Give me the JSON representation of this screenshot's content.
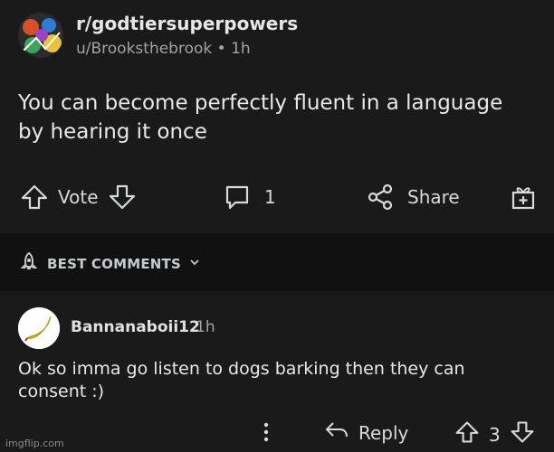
{
  "post": {
    "subreddit": "r/godtiersuperpowers",
    "meta": "u/Brooksthebrook • 1h",
    "title": "You can become perfectly fluent in a language by hearing it once",
    "vote_label": "Vote",
    "comment_count": "1",
    "share_label": "Share"
  },
  "sort": {
    "label": "BEST COMMENTS"
  },
  "comment": {
    "username": "Bannanaboii12",
    "time": "1h",
    "body": "Ok so imma go listen to dogs barking then they can consent :)",
    "reply_label": "Reply",
    "score": "3"
  },
  "watermark": "imgflip.com",
  "colors": {
    "background": "#1a1a1b",
    "band": "#111112",
    "text": "#d7dadc",
    "muted": "#a0a3a6",
    "banana": "#f2c200"
  },
  "icons": [
    "upvote-icon",
    "downvote-icon",
    "comment-icon",
    "share-icon",
    "award-icon",
    "rocket-icon",
    "chevron-down-icon",
    "more-icon",
    "reply-icon"
  ]
}
